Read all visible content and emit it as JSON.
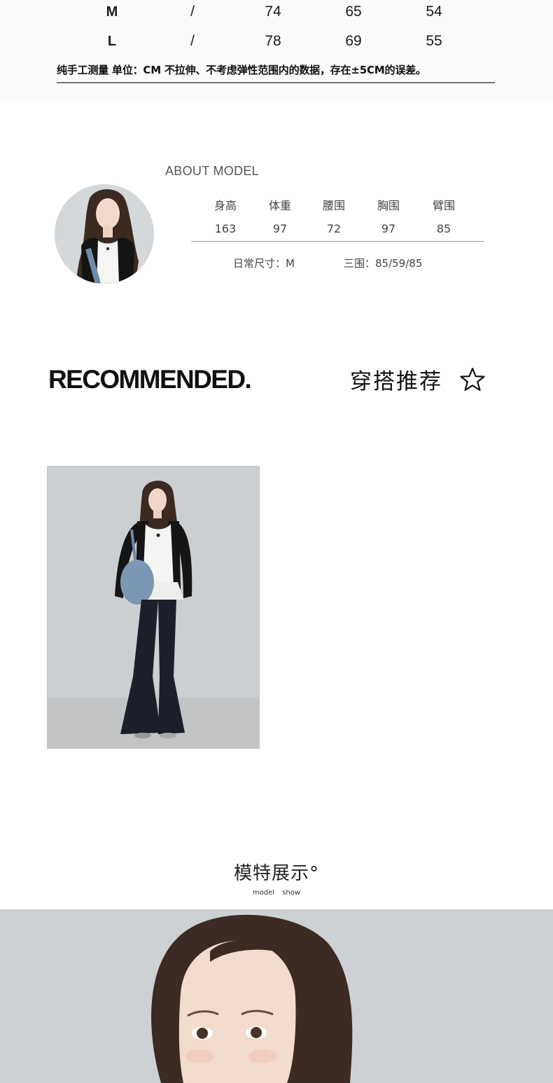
{
  "size_table": {
    "rows": [
      {
        "size": "M",
        "c1": "/",
        "c2": "74",
        "c3": "65",
        "c4": "54"
      },
      {
        "size": "L",
        "c1": "/",
        "c2": "78",
        "c3": "69",
        "c4": "55"
      }
    ],
    "note": "纯手工测量  单位：CM  不拉伸、不考虑弹性范围内的数据，存在±5CM的误差。"
  },
  "about_model": {
    "title": "ABOUT MODEL",
    "headers": [
      "身高",
      "体重",
      "腰围",
      "胸围",
      "臂围"
    ],
    "values": [
      "163",
      "97",
      "72",
      "97",
      "85"
    ],
    "daily_size": "日常尺寸：M",
    "measurements": "三围：85/59/85"
  },
  "recommended": {
    "title_en": "RECOMMENDED.",
    "title_cn": "穿搭推荐"
  },
  "model_show": {
    "title": "模特展示°",
    "subtitle": "model show"
  },
  "colors": {
    "background": "#ffffff",
    "section_bg": "#fbfbfb",
    "photo_bg": "#cdd1d4"
  }
}
